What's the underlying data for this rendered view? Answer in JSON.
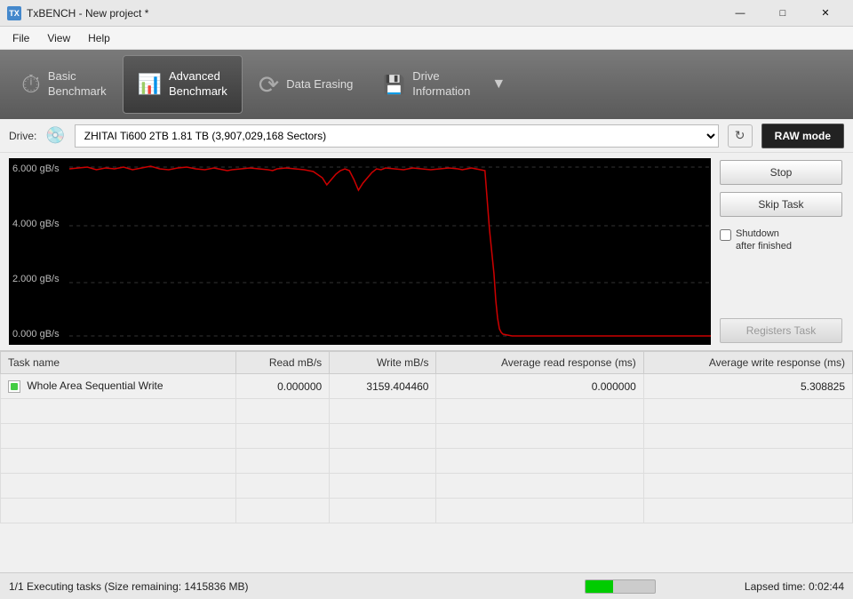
{
  "titlebar": {
    "icon": "TX",
    "title": "TxBENCH - New project *",
    "minimize": "—",
    "maximize": "□",
    "close": "✕"
  },
  "menubar": {
    "items": [
      "File",
      "View",
      "Help"
    ]
  },
  "toolbar": {
    "buttons": [
      {
        "id": "basic",
        "icon": "⏱",
        "label": "Basic\nBenchmark",
        "active": false
      },
      {
        "id": "advanced",
        "icon": "📊",
        "label": "Advanced\nBenchmark",
        "active": true
      },
      {
        "id": "erasing",
        "icon": "⟳",
        "label": "Data Erasing",
        "active": false
      },
      {
        "id": "info",
        "icon": "💾",
        "label": "Drive\nInformation",
        "active": false
      }
    ],
    "more": "▼"
  },
  "drive": {
    "label": "Drive:",
    "icon": "💿",
    "value": "ZHITAI Ti600 2TB  1.81 TB (3,907,029,168 Sectors)",
    "raw_mode_label": "RAW mode"
  },
  "chart": {
    "y_labels": [
      "6.000 gB/s",
      "4.000 gB/s",
      "2.000 gB/s",
      "0.000 gB/s"
    ]
  },
  "controls": {
    "stop_label": "Stop",
    "skip_task_label": "Skip Task",
    "shutdown_label": "Shutdown\nafter finished",
    "registers_task_label": "Registers Task"
  },
  "table": {
    "columns": [
      "Task name",
      "Read mB/s",
      "Write mB/s",
      "Average read response (ms)",
      "Average write response (ms)"
    ],
    "rows": [
      {
        "name": "Whole Area Sequential Write",
        "read": "0.000000",
        "write": "3159.404460",
        "avg_read": "0.000000",
        "avg_write": "5.308825"
      }
    ]
  },
  "statusbar": {
    "text": "1/1 Executing tasks (Size remaining: 1415836 MB)",
    "progress": 40,
    "lapsed": "Lapsed time: 0:02:44"
  }
}
